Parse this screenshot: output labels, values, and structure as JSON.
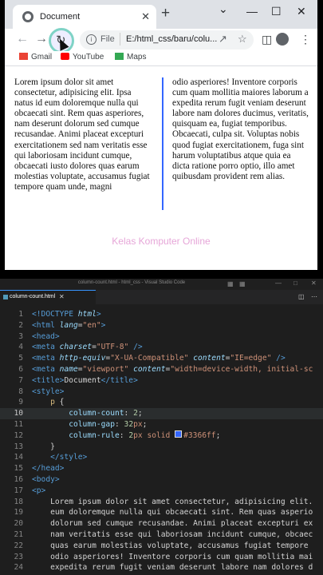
{
  "browser": {
    "tab_title": "Document",
    "tab_close": "✕",
    "new_tab": "+",
    "win_minimize": "⌄",
    "win_min": "—",
    "win_max": "☐",
    "win_close": "✕",
    "url_scheme": "File",
    "url": "E:/html_css/baru/colu...",
    "bookmarks": [
      {
        "label": "Gmail",
        "icon": "gmail-icon",
        "color": "#ea4335"
      },
      {
        "label": "YouTube",
        "icon": "youtube-icon",
        "color": "#ff0000"
      },
      {
        "label": "Maps",
        "icon": "maps-icon",
        "color": "#34a853"
      }
    ]
  },
  "page": {
    "col1": "Lorem ipsum dolor sit amet consectetur, adipisicing elit. Ipsa natus id eum doloremque nulla qui obcaecati sint. Rem quas asperiores, nam deserunt dolorum sed cumque recusandae. Animi placeat excepturi exercitationem sed nam veritatis esse qui laboriosam incidunt cumque, obcaecati iusto dolores quas earum molestias voluptate, accusamus fugiat tempore quam unde, magni",
    "col2": "odio asperiores! Inventore corporis cum quam mollitia maiores laborum a expedita rerum fugit veniam deserunt labore nam dolores ducimus, veritatis, quisquam ea, fugiat temporibus. Obcaecati, culpa sit. Voluptas nobis quod fugiat exercitationem, fuga sint harum voluptatibus atque quia ea dicta ratione porro optio, illo amet quibusdam provident rem alias.",
    "rule_color": "#3366ff",
    "watermark": "Kelas Komputer Online"
  },
  "editor": {
    "window_title": "column-count.html - html_css - Visual Studio Code",
    "tab_label": "column-count.html",
    "tab_close": "✕",
    "current_line": 10,
    "lines": [
      {
        "n": "1",
        "parts": [
          [
            "t-tag",
            "<!DOCTYPE "
          ],
          [
            "t-attr-i",
            "html"
          ],
          [
            "t-tag",
            ">"
          ]
        ]
      },
      {
        "n": "2",
        "parts": [
          [
            "t-tag",
            "<html "
          ],
          [
            "t-attr-i",
            "lang"
          ],
          [
            "t-txt",
            "="
          ],
          [
            "t-str",
            "\"en\""
          ],
          [
            "t-tag",
            ">"
          ]
        ]
      },
      {
        "n": "3",
        "parts": [
          [
            "t-tag",
            "<head>"
          ]
        ]
      },
      {
        "n": "4",
        "parts": [
          [
            "t-tag",
            "<meta "
          ],
          [
            "t-attr-i",
            "charset"
          ],
          [
            "t-txt",
            "="
          ],
          [
            "t-str",
            "\"UTF-8\""
          ],
          [
            "t-tag",
            " />"
          ]
        ]
      },
      {
        "n": "5",
        "parts": [
          [
            "t-tag",
            "<meta "
          ],
          [
            "t-attr-i",
            "http-equiv"
          ],
          [
            "t-txt",
            "="
          ],
          [
            "t-str",
            "\"X-UA-Compatible\""
          ],
          [
            "t-txt",
            " "
          ],
          [
            "t-attr-i",
            "content"
          ],
          [
            "t-txt",
            "="
          ],
          [
            "t-str",
            "\"IE=edge\""
          ],
          [
            "t-tag",
            " />"
          ]
        ]
      },
      {
        "n": "6",
        "parts": [
          [
            "t-tag",
            "<meta "
          ],
          [
            "t-attr-i",
            "name"
          ],
          [
            "t-txt",
            "="
          ],
          [
            "t-str",
            "\"viewport\""
          ],
          [
            "t-txt",
            " "
          ],
          [
            "t-attr-i",
            "content"
          ],
          [
            "t-txt",
            "="
          ],
          [
            "t-str",
            "\"width=device-width, initial-sc"
          ]
        ]
      },
      {
        "n": "7",
        "parts": [
          [
            "t-tag",
            "<title>"
          ],
          [
            "t-txt",
            "Document"
          ],
          [
            "t-tag",
            "</title>"
          ]
        ]
      },
      {
        "n": "8",
        "parts": [
          [
            "t-tag",
            "<style>"
          ]
        ]
      },
      {
        "n": "9",
        "parts": [
          [
            "t-txt",
            "    "
          ],
          [
            "t-sel",
            "p"
          ],
          [
            "t-txt",
            " {"
          ]
        ]
      },
      {
        "n": "10",
        "parts": [
          [
            "t-txt",
            "        "
          ],
          [
            "t-prop",
            "column-count"
          ],
          [
            "t-txt",
            ": "
          ],
          [
            "t-num",
            "2"
          ],
          [
            "t-txt",
            ";"
          ]
        ]
      },
      {
        "n": "11",
        "parts": [
          [
            "t-txt",
            "        "
          ],
          [
            "t-prop",
            "column-gap"
          ],
          [
            "t-txt",
            ": "
          ],
          [
            "t-num",
            "32"
          ],
          [
            "t-kw",
            "px"
          ],
          [
            "t-txt",
            ";"
          ]
        ]
      },
      {
        "n": "12",
        "parts": [
          [
            "t-txt",
            "        "
          ],
          [
            "t-prop",
            "column-rule"
          ],
          [
            "t-txt",
            ": "
          ],
          [
            "t-num",
            "2"
          ],
          [
            "t-kw",
            "px"
          ],
          [
            "t-txt",
            " "
          ],
          [
            "t-kw",
            "solid"
          ],
          [
            "t-txt",
            " "
          ],
          [
            "swatch",
            ""
          ],
          [
            "t-kw",
            "#3366ff"
          ],
          [
            "t-txt",
            ";"
          ]
        ]
      },
      {
        "n": "13",
        "parts": [
          [
            "t-txt",
            "    }"
          ]
        ]
      },
      {
        "n": "14",
        "parts": [
          [
            "t-txt",
            "    "
          ],
          [
            "t-tag",
            "</style>"
          ]
        ]
      },
      {
        "n": "15",
        "parts": [
          [
            "t-tag",
            "</head>"
          ]
        ]
      },
      {
        "n": "16",
        "parts": [
          [
            "t-tag",
            "<body>"
          ]
        ]
      },
      {
        "n": "17",
        "parts": [
          [
            "t-tag",
            "<p>"
          ]
        ]
      },
      {
        "n": "18",
        "parts": [
          [
            "t-txt",
            "    Lorem ipsum dolor sit amet consectetur, adipisicing elit."
          ]
        ]
      },
      {
        "n": "19",
        "parts": [
          [
            "t-txt",
            "    eum doloremque nulla qui obcaecati sint. Rem quas asperio"
          ]
        ]
      },
      {
        "n": "20",
        "parts": [
          [
            "t-txt",
            "    dolorum sed cumque recusandae. Animi placeat excepturi ex"
          ]
        ]
      },
      {
        "n": "21",
        "parts": [
          [
            "t-txt",
            "    nam veritatis esse qui laboriosam incidunt cumque, obcaec"
          ]
        ]
      },
      {
        "n": "22",
        "parts": [
          [
            "t-txt",
            "    quas earum molestias voluptate, accusamus fugiat tempore "
          ]
        ]
      },
      {
        "n": "23",
        "parts": [
          [
            "t-txt",
            "    odio asperiores! Inventore corporis cum quam mollitia mai"
          ]
        ]
      },
      {
        "n": "24",
        "parts": [
          [
            "t-txt",
            "    expedita rerum fugit veniam deserunt labore nam dolores d"
          ]
        ]
      }
    ]
  }
}
